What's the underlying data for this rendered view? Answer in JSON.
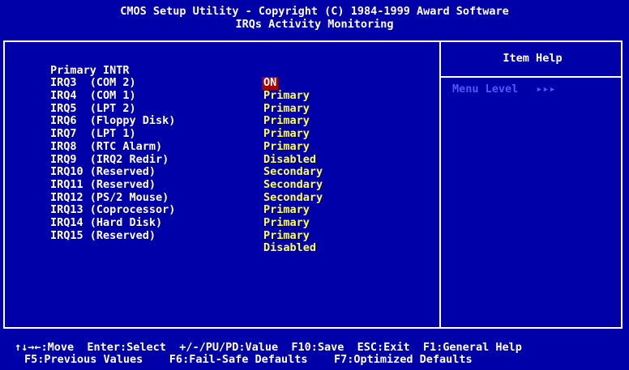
{
  "header": {
    "title": "CMOS Setup Utility - Copyright (C) 1984-1999 Award Software",
    "subtitle": "IRQs Activity Monitoring"
  },
  "settings": [
    {
      "label": "Primary INTR",
      "value": "ON"
    },
    {
      "label": "IRQ3  (COM 2)",
      "value": "Primary"
    },
    {
      "label": "IRQ4  (COM 1)",
      "value": "Primary"
    },
    {
      "label": "IRQ5  (LPT 2)",
      "value": "Primary"
    },
    {
      "label": "IRQ6  (Floppy Disk)",
      "value": "Primary"
    },
    {
      "label": "IRQ7  (LPT 1)",
      "value": "Primary"
    },
    {
      "label": "IRQ8  (RTC Alarm)",
      "value": "Disabled"
    },
    {
      "label": "IRQ9  (IRQ2 Redir)",
      "value": "Secondary"
    },
    {
      "label": "IRQ10 (Reserved)",
      "value": "Secondary"
    },
    {
      "label": "IRQ11 (Reserved)",
      "value": "Secondary"
    },
    {
      "label": "IRQ12 (PS/2 Mouse)",
      "value": "Primary"
    },
    {
      "label": "IRQ13 (Coprocessor)",
      "value": "Primary"
    },
    {
      "label": "IRQ14 (Hard Disk)",
      "value": "Primary"
    },
    {
      "label": "IRQ15 (Reserved)",
      "value": "Disabled"
    }
  ],
  "help": {
    "title": "Item Help",
    "menu_level_label": "Menu Level",
    "menu_level_arrows": "▸▸▸"
  },
  "footer": {
    "line1": "↑↓→←:Move  Enter:Select  +/-/PU/PD:Value  F10:Save  ESC:Exit  F1:General Help",
    "line2": "F5:Previous Values    F6:Fail-Safe Defaults    F7:Optimized Defaults"
  },
  "colors": {
    "background": "#0000a8",
    "value": "#ffff55",
    "selected_bg": "#a80000",
    "menu_level": "#5555ff"
  }
}
